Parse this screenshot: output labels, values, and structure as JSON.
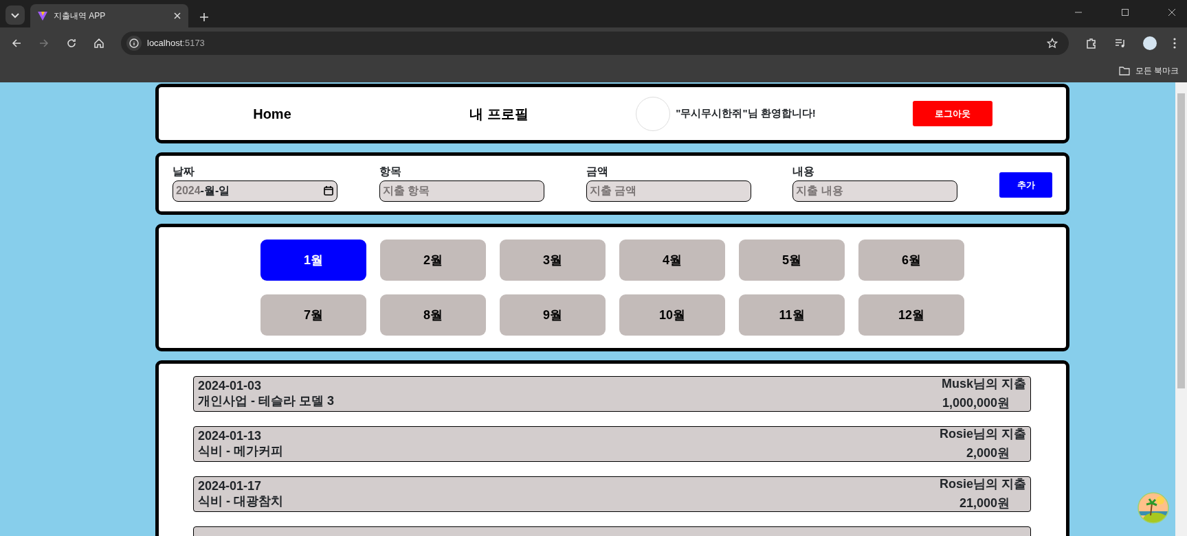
{
  "browser": {
    "tab_title": "지출내역 APP",
    "url_host": "localhost",
    "url_port": ":5173",
    "bookmarks_label": "모든 북마크"
  },
  "header": {
    "nav": [
      "Home",
      "내 프로필"
    ],
    "welcome": "\"무시무시한쥐\"님 환영합니다!",
    "logout": "로그아웃"
  },
  "form": {
    "fields": [
      {
        "label": "날짜",
        "kind": "date",
        "year": "2024",
        "rest": "-월-일"
      },
      {
        "label": "항목",
        "kind": "text",
        "placeholder": "지출 항목"
      },
      {
        "label": "금액",
        "kind": "text",
        "placeholder": "지출 금액"
      },
      {
        "label": "내용",
        "kind": "text",
        "placeholder": "지출 내용"
      }
    ],
    "add_button": "추가"
  },
  "months": [
    {
      "label": "1월",
      "selected": true
    },
    {
      "label": "2월",
      "selected": false
    },
    {
      "label": "3월",
      "selected": false
    },
    {
      "label": "4월",
      "selected": false
    },
    {
      "label": "5월",
      "selected": false
    },
    {
      "label": "6월",
      "selected": false
    },
    {
      "label": "7월",
      "selected": false
    },
    {
      "label": "8월",
      "selected": false
    },
    {
      "label": "9월",
      "selected": false
    },
    {
      "label": "10월",
      "selected": false
    },
    {
      "label": "11월",
      "selected": false
    },
    {
      "label": "12월",
      "selected": false
    }
  ],
  "expenses": [
    {
      "date": "2024-01-03",
      "description": "개인사업 - 테슬라 모델 3",
      "owner": "Musk님의 지출",
      "amount": "1,000,000원"
    },
    {
      "date": "2024-01-13",
      "description": "식비 - 메가커피",
      "owner": "Rosie님의 지출",
      "amount": "2,000원"
    },
    {
      "date": "2024-01-17",
      "description": "식비 - 대광참치",
      "owner": "Rosie님의 지출",
      "amount": "21,000원"
    }
  ]
}
